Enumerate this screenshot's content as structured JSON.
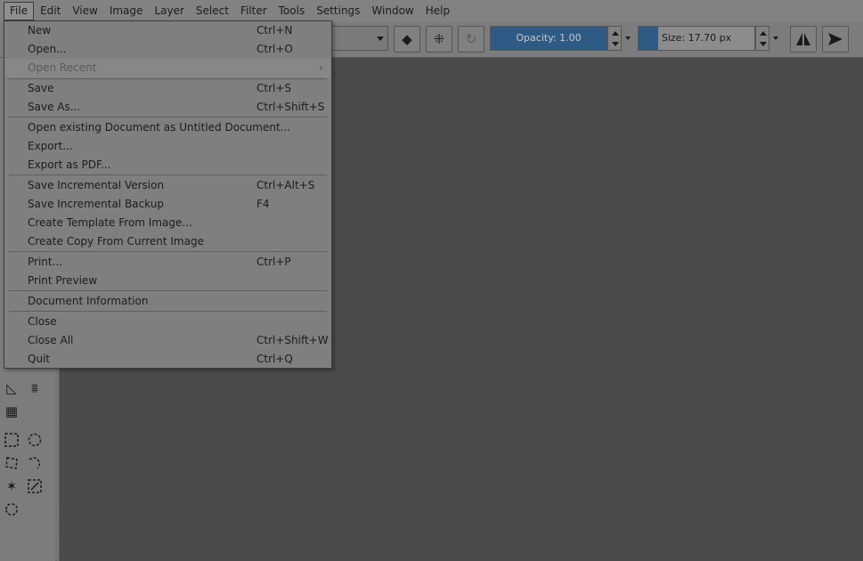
{
  "menubar": [
    "File",
    "Edit",
    "View",
    "Image",
    "Layer",
    "Select",
    "Filter",
    "Tools",
    "Settings",
    "Window",
    "Help"
  ],
  "toolbar": {
    "opacity_label": "Opacity:  1.00",
    "opacity_fill": 1.0,
    "size_label": "Size:  17.70 px",
    "size_fill": 0.17
  },
  "file_menu": {
    "items": [
      {
        "label": "New",
        "shortcut": "Ctrl+N"
      },
      {
        "label": "Open...",
        "shortcut": "Ctrl+O"
      },
      {
        "label": "Open Recent",
        "shortcut": ""
      },
      {
        "label": "Save",
        "shortcut": "Ctrl+S"
      },
      {
        "label": "Save As...",
        "shortcut": "Ctrl+Shift+S"
      },
      {
        "label": "Open existing Document as Untitled Document...",
        "shortcut": ""
      },
      {
        "label": "Export...",
        "shortcut": ""
      },
      {
        "label": "Export as PDF...",
        "shortcut": ""
      },
      {
        "label": "Save Incremental Version",
        "shortcut": "Ctrl+Alt+S"
      },
      {
        "label": "Save Incremental Backup",
        "shortcut": "F4"
      },
      {
        "label": "Create Template From Image...",
        "shortcut": ""
      },
      {
        "label": "Create Copy From Current Image",
        "shortcut": ""
      },
      {
        "label": "Print...",
        "shortcut": "Ctrl+P"
      },
      {
        "label": "Print Preview",
        "shortcut": ""
      },
      {
        "label": "Document Information",
        "shortcut": ""
      },
      {
        "label": "Close",
        "shortcut": ""
      },
      {
        "label": "Close All",
        "shortcut": "Ctrl+Shift+W"
      },
      {
        "label": "Quit",
        "shortcut": "Ctrl+Q"
      }
    ]
  },
  "colors": {
    "accent": "#2e5a86",
    "menu_bg": "#7f7f7f",
    "canvas": "#4b4b4b"
  }
}
